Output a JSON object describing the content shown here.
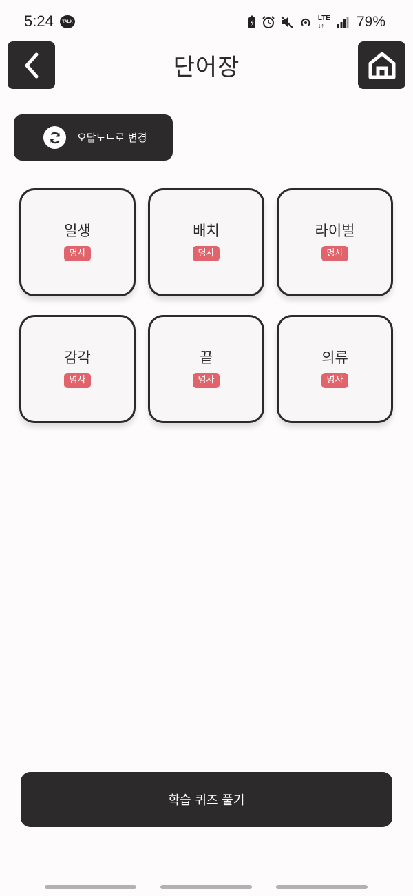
{
  "status_bar": {
    "time": "5:24",
    "talk_badge": "TALK",
    "network": "LTE",
    "battery": "79%"
  },
  "header": {
    "title": "단어장",
    "back_icon": "chevron-left-icon",
    "home_icon": "home-icon"
  },
  "mode_toggle": {
    "label": "오답노트로 변경",
    "icon": "refresh-icon"
  },
  "words": [
    {
      "word": "일생",
      "pos": "명사"
    },
    {
      "word": "배치",
      "pos": "명사"
    },
    {
      "word": "라이벌",
      "pos": "명사"
    },
    {
      "word": "감각",
      "pos": "명사"
    },
    {
      "word": "끝",
      "pos": "명사"
    },
    {
      "word": "의류",
      "pos": "명사"
    }
  ],
  "quiz_button": {
    "label": "학습 퀴즈 풀기"
  },
  "colors": {
    "primary_dark": "#2c2a2b",
    "badge_red": "#e1636b",
    "background": "#fdfbfb",
    "card_bg": "#f8f6f6"
  }
}
